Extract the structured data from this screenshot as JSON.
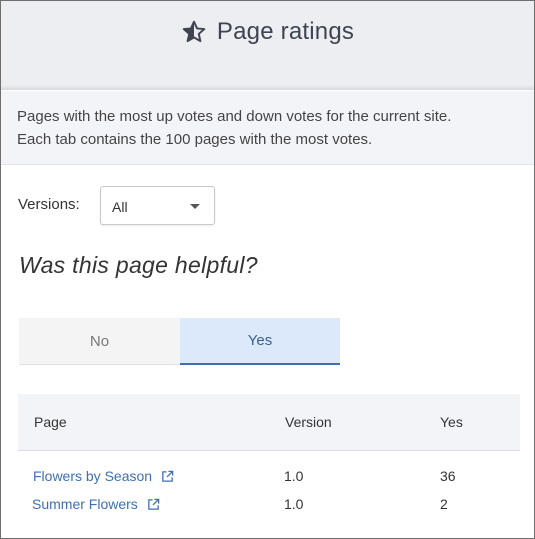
{
  "header": {
    "title": "Page ratings",
    "icon": "star-half-icon"
  },
  "description": {
    "line1": "Pages with the most up votes and down votes for the current site.",
    "line2": "Each tab contains the 100 pages with the most votes."
  },
  "versions": {
    "label": "Versions:",
    "selected": "All"
  },
  "question": "Was this page helpful?",
  "tabs": {
    "no_label": "No",
    "yes_label": "Yes",
    "active": "Yes"
  },
  "table": {
    "headers": {
      "page": "Page",
      "version": "Version",
      "count": "Yes"
    },
    "rows": [
      {
        "page": "Flowers by Season",
        "version": "1.0",
        "count": "36"
      },
      {
        "page": "Summer Flowers",
        "version": "1.0",
        "count": "2"
      }
    ]
  },
  "colors": {
    "accent": "#3f6fb2",
    "active_tab_bg": "#dbe9fb",
    "header_bg": "#edeef2"
  }
}
